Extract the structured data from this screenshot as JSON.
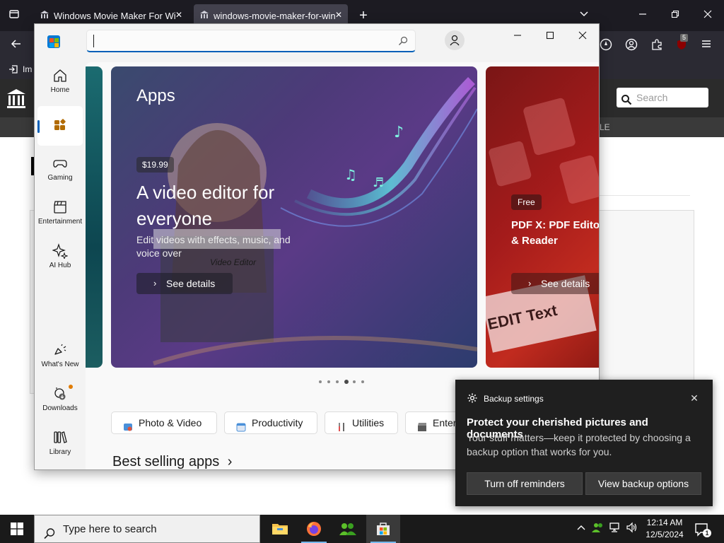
{
  "firefox": {
    "tabs": [
      {
        "title": "Windows Movie Maker For Windows"
      },
      {
        "title": "windows-movie-maker-for-windows"
      }
    ],
    "new_tab_glyph": "+",
    "bookmark_label": "Im",
    "extension_badge": "5",
    "site": {
      "search_placeholder": "Search",
      "nav_fragment": "LE"
    }
  },
  "store": {
    "sidebar": [
      {
        "label": "Home",
        "icon": "home-icon"
      },
      {
        "label": "",
        "icon": "apps-icon",
        "active": true
      },
      {
        "label": "Gaming",
        "icon": "gamepad-icon"
      },
      {
        "label": "Entertainment",
        "icon": "clapperboard-icon"
      },
      {
        "label": "AI Hub",
        "icon": "sparkle-icon"
      },
      {
        "label": "What's New",
        "icon": "megaphone-icon"
      },
      {
        "label": "Downloads",
        "icon": "download-icon"
      },
      {
        "label": "Library",
        "icon": "library-icon"
      }
    ],
    "hero": {
      "kicker": "Apps",
      "price": "$19.99",
      "title": "A video editor for everyone",
      "description": "Edit videos with effects, music, and voice over",
      "button": "See details",
      "clapper_text": "Video Editor"
    },
    "hero_right": {
      "price": "Free",
      "title": "PDF X: PDF Editor & Reader",
      "button": "See details",
      "art_text": "EDIT Text"
    },
    "carousel": {
      "count": 6,
      "active_index": 3
    },
    "categories": [
      {
        "label": "Photo & Video"
      },
      {
        "label": "Productivity"
      },
      {
        "label": "Utilities"
      },
      {
        "label": "Entertainment"
      }
    ],
    "section_title": "Best selling apps",
    "section_chevron": "›"
  },
  "toast": {
    "app": "Backup settings",
    "title": "Protect your cherished pictures and documents",
    "body": "Your stuff matters—keep it protected by choosing a backup option that works for you.",
    "btn_primary": "Turn off reminders",
    "btn_secondary": "View backup options"
  },
  "taskbar": {
    "search_placeholder": "Type here to search",
    "time": "12:14 AM",
    "date": "12/5/2024",
    "notification_count": "1"
  },
  "colors": {
    "accent": "#005fb8",
    "toast_bg": "#1f1f1f",
    "taskbar_bg": "#1a1a1a"
  }
}
